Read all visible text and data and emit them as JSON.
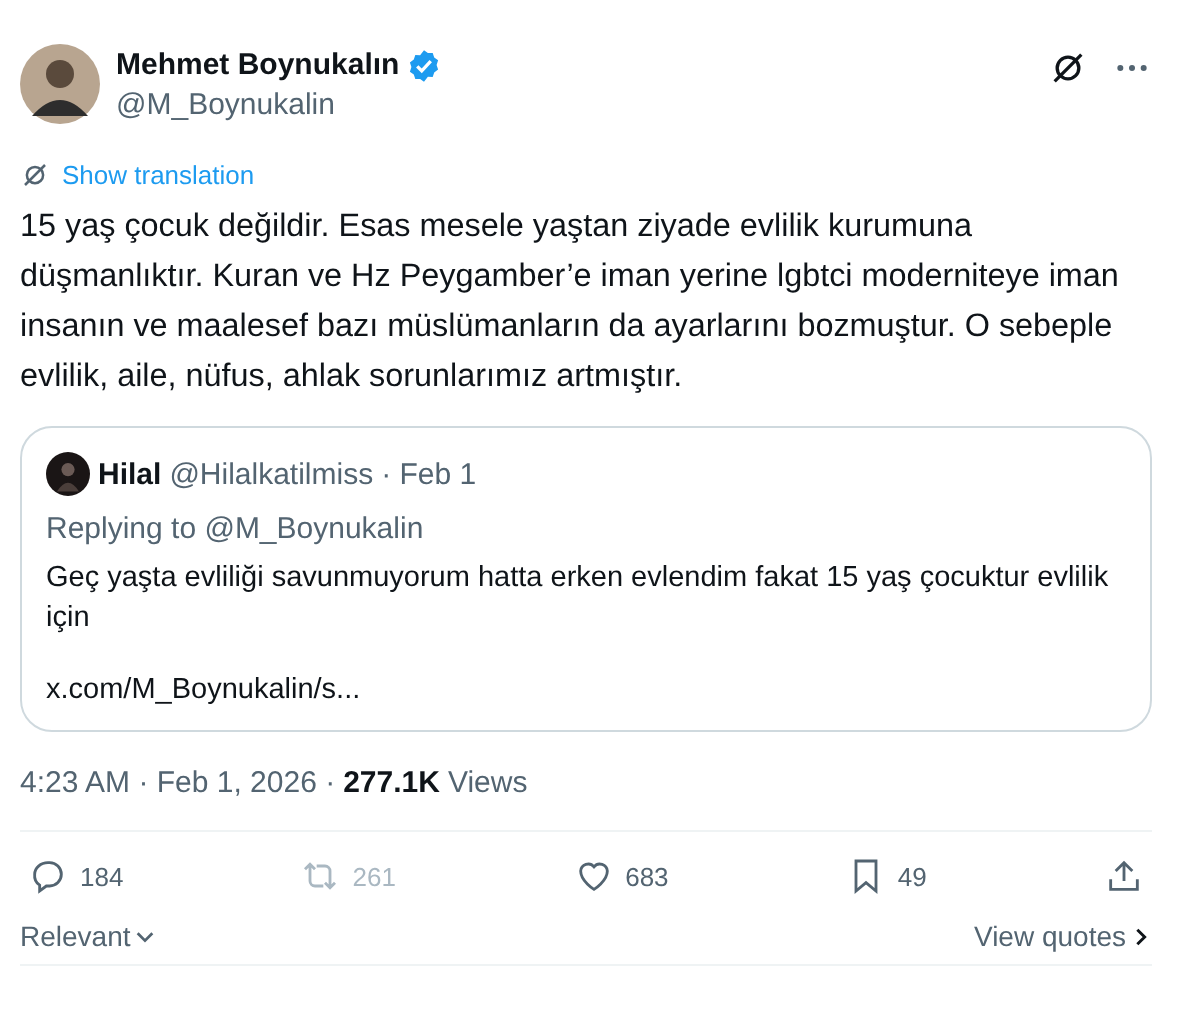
{
  "author": {
    "name": "Mehmet Boynukalın",
    "handle": "@M_Boynukalin",
    "verified": true
  },
  "translate_link": "Show translation",
  "body": "15 yaş çocuk değildir. Esas mesele yaştan ziyade evlilik kurumuna düşmanlıktır. Kuran ve Hz  Peygamber’e iman yerine lgbtci moderniteye iman insanın ve maalesef bazı müslümanların da ayarlarını bozmuştur. O sebeple evlilik, aile, nüfus, ahlak sorunlarımız artmıştır.",
  "quote": {
    "name": "Hilal",
    "handle": "@Hilalkatilmiss",
    "date": "· Feb 1",
    "replying": "Replying to @M_Boynukalin",
    "text": "Geç yaşta evliliği savunmuyorum hatta erken evlendim fakat 15 yaş çocuktur evlilik için",
    "link": "x.com/M_Boynukalin/s..."
  },
  "meta": {
    "time": "4:23 AM · Feb 1, 2026 ·",
    "views": "277.1K",
    "views_label": "Views"
  },
  "actions": [
    {
      "kind": "reply",
      "count": "184",
      "disabled": false
    },
    {
      "kind": "repost",
      "count": "261",
      "disabled": true
    },
    {
      "kind": "like",
      "count": "683",
      "disabled": false
    },
    {
      "kind": "bookmark",
      "count": "49",
      "disabled": false
    },
    {
      "kind": "share",
      "disabled": false
    }
  ],
  "sort": "Relevant",
  "view_quotes": "View quotes"
}
